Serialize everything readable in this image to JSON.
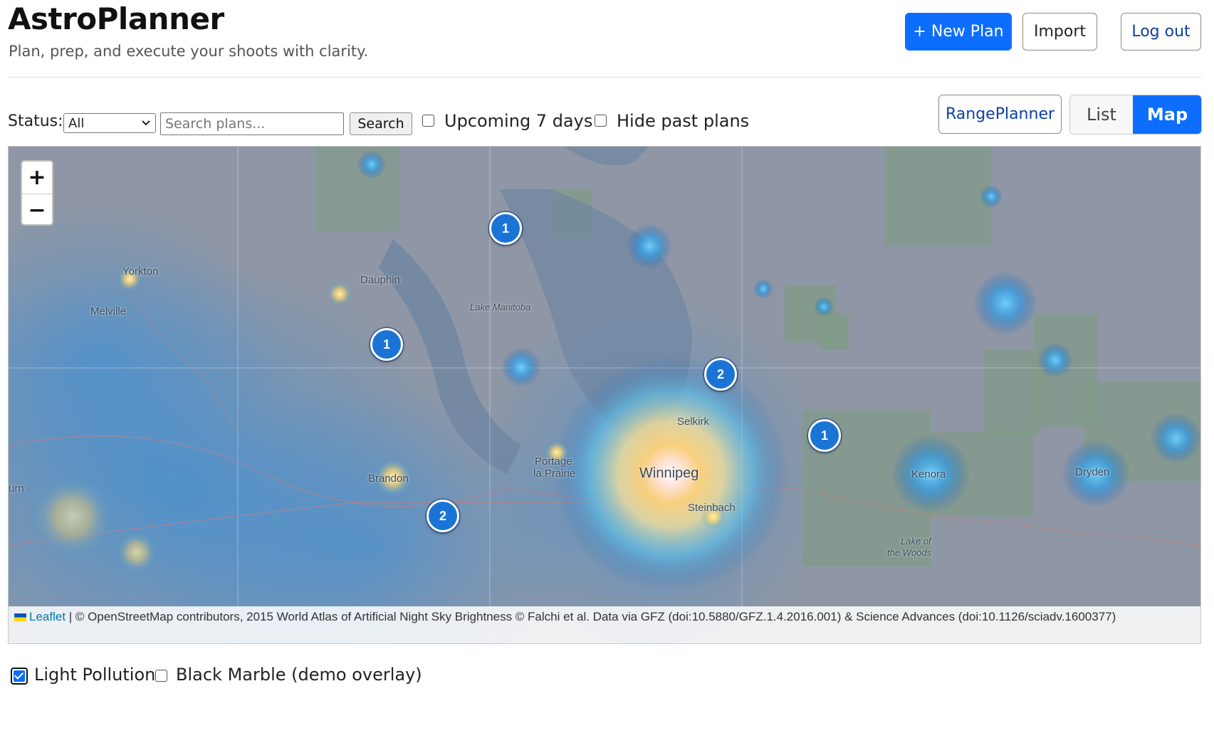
{
  "app": {
    "title": "AstroPlanner",
    "tagline": "Plan, prep, and execute your shoots with clarity."
  },
  "header_actions": {
    "new_plan": "+ New Plan",
    "import": "Import",
    "logout": "Log out"
  },
  "filters": {
    "status_label": "Status:",
    "status_selected": "All",
    "search_placeholder": "Search plans...",
    "search_button": "Search",
    "upcoming_label": "Upcoming 7 days",
    "upcoming_checked": false,
    "hide_past_label": "Hide past plans",
    "hide_past_checked": false
  },
  "view_controls": {
    "range_planner": "RangePlanner",
    "list": "List",
    "map": "Map",
    "active": "Map"
  },
  "map": {
    "zoom_in": "+",
    "zoom_out": "−",
    "cities": [
      {
        "id": "yorkton",
        "name": "Yorkton"
      },
      {
        "id": "melville",
        "name": "Melville"
      },
      {
        "id": "dauphin",
        "name": "Dauphin"
      },
      {
        "id": "lake_manitoba",
        "name": "Lake Manitoba"
      },
      {
        "id": "selkirk",
        "name": "Selkirk"
      },
      {
        "id": "portage1",
        "name": "Portage"
      },
      {
        "id": "portage2",
        "name": "la Prairie"
      },
      {
        "id": "winnipeg",
        "name": "Winnipeg"
      },
      {
        "id": "brandon",
        "name": "Brandon"
      },
      {
        "id": "steinbach",
        "name": "Steinbach"
      },
      {
        "id": "kenora",
        "name": "Kenora"
      },
      {
        "id": "dryden",
        "name": "Dryden"
      },
      {
        "id": "lotw1",
        "name": "Lake of"
      },
      {
        "id": "lotw2",
        "name": "the Woods"
      },
      {
        "id": "urn",
        "name": "urn"
      }
    ],
    "clusters": [
      {
        "id": "c1",
        "count": "1"
      },
      {
        "id": "c2",
        "count": "1"
      },
      {
        "id": "c3",
        "count": "2"
      },
      {
        "id": "c4",
        "count": "1"
      },
      {
        "id": "c5",
        "count": "2"
      }
    ],
    "attribution": {
      "leaflet": "Leaflet",
      "text": " | © OpenStreetMap contributors, 2015 World Atlas of Artificial Night Sky Brightness © Falchi et al. Data via GFZ (doi:10.5880/GFZ.1.4.2016.001) & Science Advances (doi:10.1126/sciadv.1600377)"
    }
  },
  "layers": {
    "light_pollution_label": "Light Pollution",
    "light_pollution_checked": true,
    "black_marble_label": "Black Marble (demo overlay)",
    "black_marble_checked": false
  },
  "colors": {
    "primary": "#0d6efd",
    "marker": "#1a74d6",
    "map_base": "#8e99a8"
  }
}
